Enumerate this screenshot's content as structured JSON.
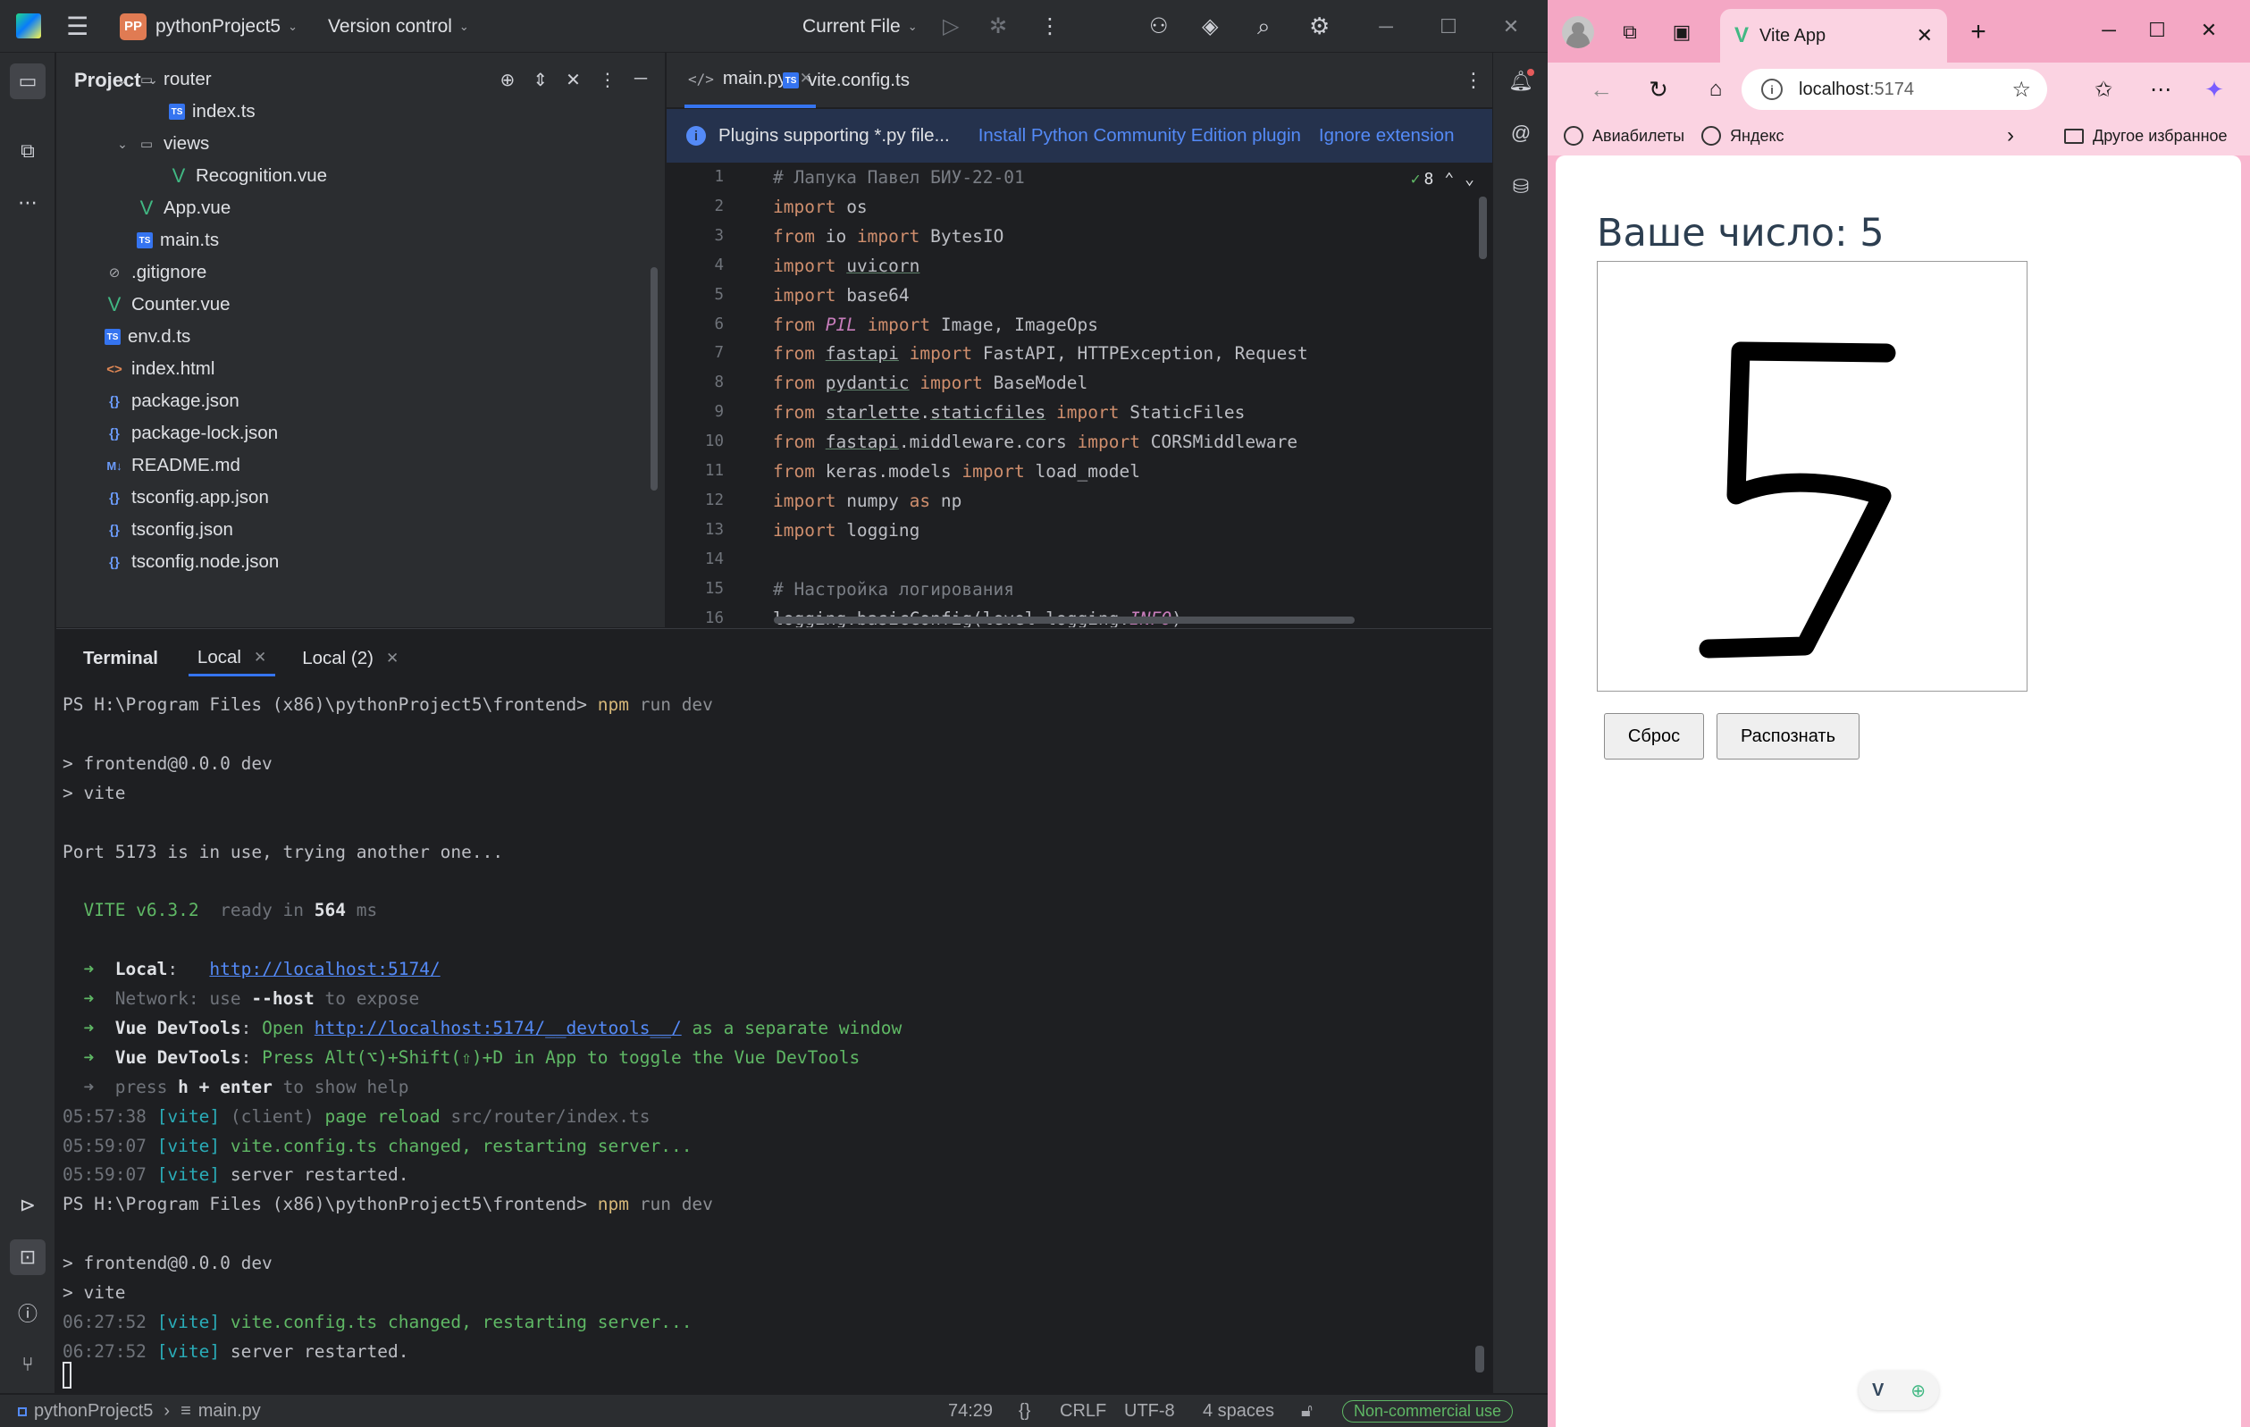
{
  "ide": {
    "project_name": "pythonProject5",
    "project_badge": "PP",
    "vcs_label": "Version control",
    "run_config": "Current File",
    "project_panel_title": "Project",
    "tree": [
      {
        "label": "router",
        "type": "folder",
        "indent": 3,
        "expanded": true
      },
      {
        "label": "index.ts",
        "type": "ts",
        "indent": 4
      },
      {
        "label": "views",
        "type": "folder",
        "indent": 3,
        "expanded": true
      },
      {
        "label": "Recognition.vue",
        "type": "vue",
        "indent": 4
      },
      {
        "label": "App.vue",
        "type": "vue",
        "indent": 3
      },
      {
        "label": "main.ts",
        "type": "ts",
        "indent": 3
      },
      {
        "label": ".gitignore",
        "type": "git",
        "indent": 2
      },
      {
        "label": "Counter.vue",
        "type": "vue",
        "indent": 2
      },
      {
        "label": "env.d.ts",
        "type": "ts",
        "indent": 2
      },
      {
        "label": "index.html",
        "type": "html",
        "indent": 2
      },
      {
        "label": "package.json",
        "type": "json",
        "indent": 2
      },
      {
        "label": "package-lock.json",
        "type": "json",
        "indent": 2
      },
      {
        "label": "README.md",
        "type": "md",
        "indent": 2
      },
      {
        "label": "tsconfig.app.json",
        "type": "json",
        "indent": 2
      },
      {
        "label": "tsconfig.json",
        "type": "json",
        "indent": 2
      },
      {
        "label": "tsconfig.node.json",
        "type": "json",
        "indent": 2
      }
    ],
    "editor_tabs": [
      {
        "label": "main.py",
        "active": true
      },
      {
        "label": "vite.config.ts",
        "active": false
      }
    ],
    "banner": {
      "text": "Plugins supporting *.py file...",
      "link1": "Install Python Community Edition plugin",
      "link2": "Ignore extension"
    },
    "inspection_count": "8",
    "code_lines": [
      {
        "n": "1",
        "html": "<span class=\"cm\"># Лапука Павел БИУ-22-01</span>"
      },
      {
        "n": "2",
        "html": "<span class=\"kw\">import</span> os"
      },
      {
        "n": "3",
        "html": "<span class=\"kw\">from</span> io <span class=\"kw\">import</span> BytesIO"
      },
      {
        "n": "4",
        "html": "<span class=\"kw\">import</span> <span class=\"ul\">uvicorn</span>"
      },
      {
        "n": "5",
        "html": "<span class=\"kw\">import</span> base64"
      },
      {
        "n": "6",
        "html": "<span class=\"kw\">from</span> <span class=\"it\">PIL</span> <span class=\"kw\">import</span> Image, ImageOps"
      },
      {
        "n": "7",
        "html": "<span class=\"kw\">from</span> <span class=\"ul\">fastapi</span> <span class=\"kw\">import</span> FastAPI, HTTPException, Request"
      },
      {
        "n": "8",
        "html": "<span class=\"kw\">from</span> <span class=\"ul\">pydantic</span> <span class=\"kw\">import</span> BaseModel"
      },
      {
        "n": "9",
        "html": "<span class=\"kw\">from</span> <span class=\"ul\">starlette</span>.<span class=\"ul\">staticfiles</span> <span class=\"kw\">import</span> StaticFiles"
      },
      {
        "n": "10",
        "html": "<span class=\"kw\">from</span> <span class=\"ul\">fastapi</span>.middleware.cors <span class=\"kw\">import</span> CORSMiddleware"
      },
      {
        "n": "11",
        "html": "<span class=\"kw\">from</span> keras.models <span class=\"kw\">import</span> load_model"
      },
      {
        "n": "12",
        "html": "<span class=\"kw\">import</span> numpy <span class=\"kw\">as</span> np"
      },
      {
        "n": "13",
        "html": "<span class=\"kw\">import</span> logging"
      },
      {
        "n": "14",
        "html": ""
      },
      {
        "n": "15",
        "html": "<span class=\"cm\"># Настройка логирования</span>"
      },
      {
        "n": "16",
        "html": "logging.basicConfig(level=logging.<span class=\"it\">INFO</span>)"
      }
    ],
    "terminal_tabs": {
      "title": "Terminal",
      "tab1": "Local",
      "tab2": "Local (2)"
    },
    "terminal_lines": [
      "PS H:\\Program Files (x86)\\pythonProject5\\frontend> <span class=\"y\">npm</span> <span class=\"gr\">run dev</span>",
      "",
      "> frontend@0.0.0 dev",
      "> vite",
      "",
      "Port 5173 is in use, trying another one...",
      "",
      "  <span class=\"g\">VITE v6.3.2</span>  <span class=\"dim\">ready in</span> <span class=\"b\">564</span> <span class=\"dim\">ms</span>",
      "",
      "  <span class=\"g\">➜</span>  <span class=\"b\">Local</span>:   <span class=\"lk\">http://localhost:5174/</span>",
      "  <span class=\"g\">➜</span>  <span class=\"dim\">Network</span><span class=\"dim\">: use </span><span class=\"b\">--host</span><span class=\"dim\"> to expose</span>",
      "  <span class=\"g\">➜</span>  <span class=\"b\">Vue DevTools</span>: <span class=\"g\">Open </span><span class=\"lk\">http://localhost:5174/__devtools__/</span><span class=\"g\"> as a separate window</span>",
      "  <span class=\"g\">➜</span>  <span class=\"b\">Vue DevTools</span>: <span class=\"g\">Press Alt(⌥)+Shift(⇧)+D in App to toggle the Vue DevTools</span>",
      "  <span class=\"dim\">➜  press </span><span class=\"b\">h + enter</span><span class=\"dim\"> to show help</span>",
      "<span class=\"dim\">05:57:38</span> <span class=\"c\">[vite]</span> <span class=\"dim\">(client)</span> <span class=\"g\">page reload</span> <span class=\"dim\">src/router/index.ts</span>",
      "<span class=\"dim\">05:59:07</span> <span class=\"c\">[vite]</span> <span class=\"g\">vite.config.ts changed, restarting server...</span>",
      "<span class=\"dim\">05:59:07</span> <span class=\"c\">[vite]</span> server restarted.",
      "PS H:\\Program Files (x86)\\pythonProject5\\frontend> <span class=\"y\">npm</span> <span class=\"gr\">run dev</span>",
      "",
      "> frontend@0.0.0 dev",
      "> vite",
      "<span class=\"dim\">06:27:52</span> <span class=\"c\">[vite]</span> <span class=\"g\">vite.config.ts changed, restarting server...</span>",
      "<span class=\"dim\">06:27:52</span> <span class=\"c\">[vite]</span> server restarted."
    ],
    "status": {
      "crumb_project": "pythonProject5",
      "crumb_file": "main.py",
      "position": "74:29",
      "line_sep": "CRLF",
      "encoding": "UTF-8",
      "indent": "4 spaces",
      "license": "Non-commercial use"
    }
  },
  "browser": {
    "tab_title": "Vite App",
    "address_host": "localhost",
    "address_port": ":5174",
    "bookmarks": [
      "Авиабилеты",
      "Яндекс"
    ],
    "other_bookmarks": "Другое избранное",
    "page": {
      "result_prefix": "Ваше число: ",
      "result_value": "5",
      "reset_button": "Сброс",
      "recognize_button": "Распознать"
    }
  },
  "colors": {
    "ide_bg": "#1e1f22",
    "ide_panel": "#2b2d30",
    "accent": "#3574f0",
    "browser_frame": "#f4a7c4"
  }
}
